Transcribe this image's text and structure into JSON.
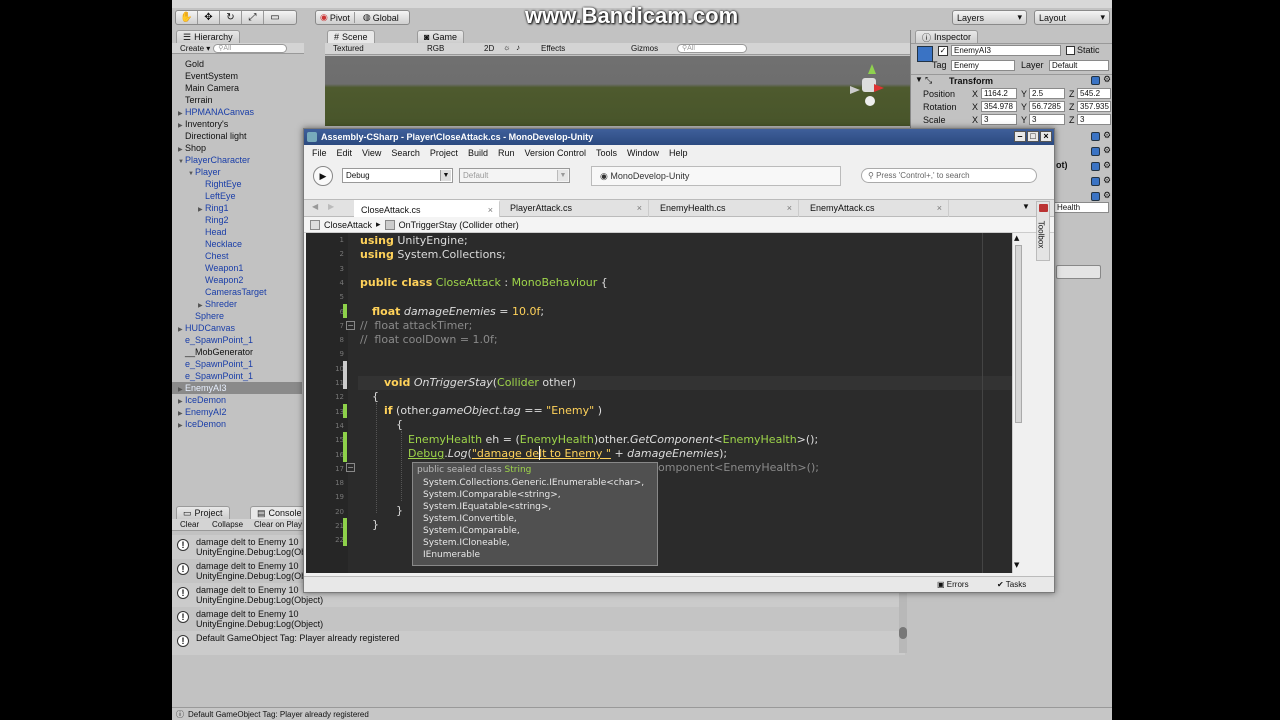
{
  "watermark": "www.Bandicam.com",
  "unity": {
    "toolbar": {
      "pivot_label": "Pivot",
      "global_label": "Global",
      "layers_label": "Layers",
      "layout_label": "Layout"
    },
    "hierarchy": {
      "tab_label": "Hierarchy",
      "create_label": "Create",
      "search_placeholder": "All",
      "items": [
        {
          "label": "Gold",
          "indent": 0,
          "arrow": false,
          "blue": false
        },
        {
          "label": "EventSystem",
          "indent": 0,
          "arrow": false,
          "blue": false
        },
        {
          "label": "Main Camera",
          "indent": 0,
          "arrow": false,
          "blue": false
        },
        {
          "label": "Terrain",
          "indent": 0,
          "arrow": false,
          "blue": false
        },
        {
          "label": "HPMANACanvas",
          "indent": 0,
          "arrow": true,
          "blue": true
        },
        {
          "label": "Inventory's",
          "indent": 0,
          "arrow": true,
          "blue": false
        },
        {
          "label": "Directional light",
          "indent": 0,
          "arrow": false,
          "blue": false
        },
        {
          "label": "Shop",
          "indent": 0,
          "arrow": true,
          "blue": false
        },
        {
          "label": "PlayerCharacter",
          "indent": 0,
          "arrow": true,
          "blue": true,
          "open": true
        },
        {
          "label": "Player",
          "indent": 1,
          "arrow": true,
          "blue": true,
          "open": true
        },
        {
          "label": "RightEye",
          "indent": 2,
          "arrow": false,
          "blue": true
        },
        {
          "label": "LeftEye",
          "indent": 2,
          "arrow": false,
          "blue": true
        },
        {
          "label": "Ring1",
          "indent": 2,
          "arrow": true,
          "blue": true
        },
        {
          "label": "Ring2",
          "indent": 2,
          "arrow": false,
          "blue": true
        },
        {
          "label": "Head",
          "indent": 2,
          "arrow": false,
          "blue": true
        },
        {
          "label": "Necklace",
          "indent": 2,
          "arrow": false,
          "blue": true
        },
        {
          "label": "Chest",
          "indent": 2,
          "arrow": false,
          "blue": true
        },
        {
          "label": "Weapon1",
          "indent": 2,
          "arrow": false,
          "blue": true
        },
        {
          "label": "Weapon2",
          "indent": 2,
          "arrow": false,
          "blue": true
        },
        {
          "label": "CamerasTarget",
          "indent": 2,
          "arrow": false,
          "blue": true
        },
        {
          "label": "Shreder",
          "indent": 2,
          "arrow": true,
          "blue": true
        },
        {
          "label": "Sphere",
          "indent": 1,
          "arrow": false,
          "blue": true
        },
        {
          "label": "HUDCanvas",
          "indent": 0,
          "arrow": true,
          "blue": true
        },
        {
          "label": "e_SpawnPoint_1",
          "indent": 0,
          "arrow": false,
          "blue": true
        },
        {
          "label": "__MobGenerator",
          "indent": 0,
          "arrow": false,
          "blue": false
        },
        {
          "label": "e_SpawnPoint_1",
          "indent": 0,
          "arrow": false,
          "blue": true
        },
        {
          "label": "e_SpawnPoint_1",
          "indent": 0,
          "arrow": false,
          "blue": true
        },
        {
          "label": "EnemyAI3",
          "indent": 0,
          "arrow": true,
          "blue": true,
          "selected": true
        },
        {
          "label": "IceDemon",
          "indent": 0,
          "arrow": true,
          "blue": true
        },
        {
          "label": "EnemyAI2",
          "indent": 0,
          "arrow": true,
          "blue": true
        },
        {
          "label": "IceDemon",
          "indent": 0,
          "arrow": true,
          "blue": true
        }
      ]
    },
    "scene": {
      "tab_scene": "Scene",
      "tab_game": "Game",
      "textured": "Textured",
      "rgb": "RGB",
      "mode_2d": "2D",
      "effects": "Effects",
      "gizmos": "Gizmos",
      "search_placeholder": "All"
    },
    "inspector": {
      "tab_label": "Inspector",
      "object_name": "EnemyAI3",
      "static_label": "Static",
      "tag_label": "Tag",
      "tag_value": "Enemy",
      "layer_label": "Layer",
      "layer_value": "Default",
      "transform_label": "Transform",
      "position_label": "Position",
      "rotation_label": "Rotation",
      "scale_label": "Scale",
      "x": "X",
      "y": "Y",
      "z": "Z",
      "pos_x": "1164.2",
      "pos_y": "2.5",
      "pos_z": "545.2",
      "rot_x": "354.978",
      "rot_y": "56.7285",
      "rot_z": "357.935",
      "scl_x": "3",
      "scl_y": "3",
      "scl_z": "3",
      "partial_1": "ot)",
      "partial_2": "Health"
    },
    "console": {
      "tab_project": "Project",
      "tab_console": "Console",
      "clear": "Clear",
      "collapse": "Collapse",
      "clear_on_play": "Clear on Play",
      "entries": [
        {
          "line1": "damage delt to Enemy 10",
          "line2": "UnityEngine.Debug:Log(Object)"
        },
        {
          "line1": "damage delt to Enemy 10",
          "line2": "UnityEngine.Debug:Log(Object)"
        },
        {
          "line1": "damage delt to Enemy 10",
          "line2": "UnityEngine.Debug:Log(Object)"
        },
        {
          "line1": "damage delt to Enemy 10",
          "line2": "UnityEngine.Debug:Log(Object)"
        },
        {
          "line1": "Default GameObject Tag: Player already registered",
          "line2": ""
        }
      ],
      "status_text": "Default GameObject Tag: Player already registered"
    }
  },
  "monodevelop": {
    "title": "Assembly-CSharp - Player\\CloseAttack.cs - MonoDevelop-Unity",
    "menu": [
      "File",
      "Edit",
      "View",
      "Search",
      "Project",
      "Build",
      "Run",
      "Version Control",
      "Tools",
      "Window",
      "Help"
    ],
    "config": "Debug",
    "platform": "Default",
    "status_app": "MonoDevelop-Unity",
    "search_placeholder": "Press 'Control+,' to search",
    "tabs": [
      "CloseAttack.cs",
      "PlayerAttack.cs",
      "EnemyHealth.cs",
      "EnemyAttack.cs"
    ],
    "breadcrumb_class": "CloseAttack",
    "breadcrumb_method": "OnTriggerStay (Collider other)",
    "toolbox_label": "Toolbox",
    "errors_label": "Errors",
    "tasks_label": "Tasks",
    "line_numbers": [
      "1",
      "2",
      "3",
      "4",
      "5",
      "6",
      "7",
      "8",
      "9",
      "10",
      "11",
      "12",
      "13",
      "14",
      "15",
      "16",
      "17",
      "18",
      "19",
      "20",
      "21",
      "22"
    ],
    "code": {
      "l1a": "using",
      "l1b": " UnityEngine;",
      "l2a": "using",
      "l2b": " System.Collections;",
      "l4a": "public class",
      "l4b": " CloseAttack",
      "l4c": " : ",
      "l4d": "MonoBehaviour",
      "l4e": " {",
      "l6a": "float",
      "l6b": " damageEnemies",
      "l6c": " = ",
      "l6d": "10.0f",
      "l6e": ";",
      "l7": "//  float attackTimer;",
      "l8": "//  float coolDown = 1.0f;",
      "l11a": "void",
      "l11b": " OnTriggerStay",
      "l11c": "(",
      "l11d": "Collider",
      "l11e": " other)",
      "l12": "{",
      "l13a": "if",
      "l13b": " (other.",
      "l13c": "gameObject",
      "l13d": ".",
      "l13e": "tag",
      "l13f": " == ",
      "l13g": "\"Enemy\"",
      "l13h": " )",
      "l14": "{",
      "l15a": "EnemyHealth",
      "l15b": " eh = (",
      "l15c": "EnemyHealth",
      "l15d": ")other.",
      "l15e": "GetComponent",
      "l15f": "<",
      "l15g": "EnemyHealth",
      "l15h": ">();",
      "l16a": "Debug",
      "l16b": ".",
      "l16c": "Log",
      "l16d": "(",
      "l16e": "\"damage delt to Enemy \"",
      "l16f": " + ",
      "l16g": "damageEnemies",
      "l16h": ");",
      "l17": "omponent<EnemyHealth>();",
      "l20": "}",
      "l21": "}"
    },
    "tooltip": {
      "header_a": "public sealed class",
      "header_b": " String",
      "lines": [
        "System.Collections.Generic.IEnumerable<char>,",
        "System.IComparable<string>,",
        "System.IEquatable<string>,",
        "System.IConvertible,",
        "System.IComparable,",
        "System.ICloneable,",
        "IEnumerable"
      ]
    }
  },
  "colors": {
    "editor_bg": "#2b2b2b",
    "keyword": "#ffd25a",
    "type": "#9ed54a",
    "change_marker": "#8ed14a",
    "unity_bg": "#c2c2c2"
  }
}
